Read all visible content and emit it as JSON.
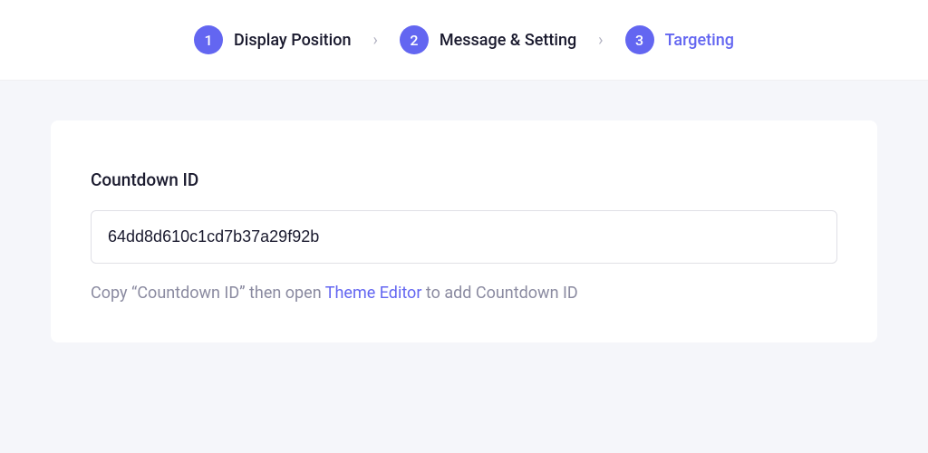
{
  "steps": [
    {
      "num": "1",
      "label": "Display Position",
      "active": false
    },
    {
      "num": "2",
      "label": "Message & Setting",
      "active": false
    },
    {
      "num": "3",
      "label": "Targeting",
      "active": true
    }
  ],
  "card": {
    "field_label": "Countdown ID",
    "field_value": "64dd8d610c1cd7b37a29f92b",
    "helper_prefix": "Copy “Countdown ID” then open ",
    "helper_link": "Theme Editor",
    "helper_suffix": " to add Countdown ID"
  }
}
